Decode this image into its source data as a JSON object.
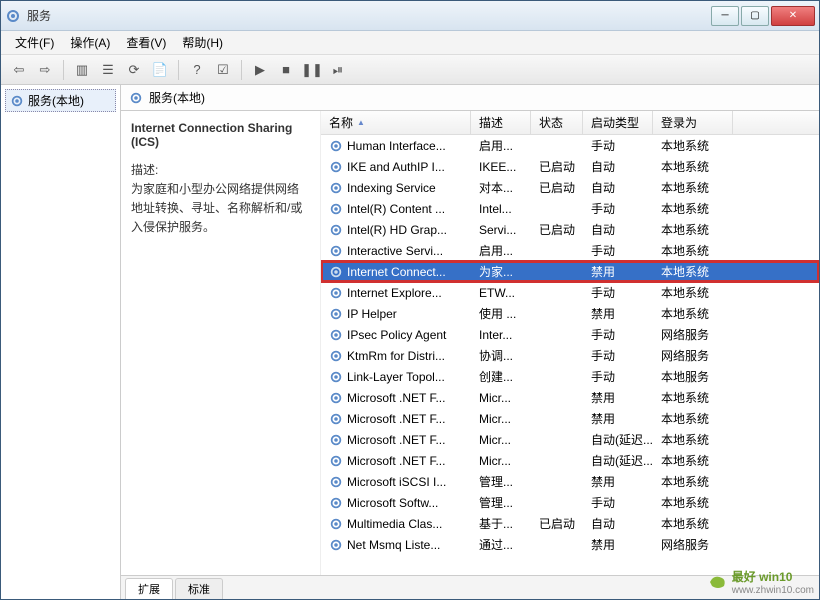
{
  "window": {
    "title": "服务"
  },
  "menu": {
    "file": "文件(F)",
    "action": "操作(A)",
    "view": "查看(V)",
    "help": "帮助(H)"
  },
  "left": {
    "node": "服务(本地)"
  },
  "panel": {
    "heading": "服务(本地)",
    "selected_name": "Internet Connection Sharing (ICS)",
    "desc_label": "描述:",
    "desc_text": "为家庭和小型办公网络提供网络地址转换、寻址、名称解析和/或入侵保护服务。"
  },
  "columns": {
    "name": "名称",
    "desc": "描述",
    "status": "状态",
    "start": "启动类型",
    "logon": "登录为"
  },
  "rows": [
    {
      "name": "Human Interface...",
      "desc": "启用...",
      "status": "",
      "start": "手动",
      "logon": "本地系统"
    },
    {
      "name": "IKE and AuthIP I...",
      "desc": "IKEE...",
      "status": "已启动",
      "start": "自动",
      "logon": "本地系统"
    },
    {
      "name": "Indexing Service",
      "desc": "对本...",
      "status": "已启动",
      "start": "自动",
      "logon": "本地系统"
    },
    {
      "name": "Intel(R) Content ...",
      "desc": "Intel...",
      "status": "",
      "start": "手动",
      "logon": "本地系统"
    },
    {
      "name": "Intel(R) HD Grap...",
      "desc": "Servi...",
      "status": "已启动",
      "start": "自动",
      "logon": "本地系统"
    },
    {
      "name": "Interactive Servi...",
      "desc": "启用...",
      "status": "",
      "start": "手动",
      "logon": "本地系统"
    },
    {
      "name": "Internet Connect...",
      "desc": "为家...",
      "status": "",
      "start": "禁用",
      "logon": "本地系统",
      "selected": true,
      "highlighted": true
    },
    {
      "name": "Internet Explore...",
      "desc": "ETW...",
      "status": "",
      "start": "手动",
      "logon": "本地系统"
    },
    {
      "name": "IP Helper",
      "desc": "使用 ...",
      "status": "",
      "start": "禁用",
      "logon": "本地系统"
    },
    {
      "name": "IPsec Policy Agent",
      "desc": "Inter...",
      "status": "",
      "start": "手动",
      "logon": "网络服务"
    },
    {
      "name": "KtmRm for Distri...",
      "desc": "协调...",
      "status": "",
      "start": "手动",
      "logon": "网络服务"
    },
    {
      "name": "Link-Layer Topol...",
      "desc": "创建...",
      "status": "",
      "start": "手动",
      "logon": "本地服务"
    },
    {
      "name": "Microsoft .NET F...",
      "desc": "Micr...",
      "status": "",
      "start": "禁用",
      "logon": "本地系统"
    },
    {
      "name": "Microsoft .NET F...",
      "desc": "Micr...",
      "status": "",
      "start": "禁用",
      "logon": "本地系统"
    },
    {
      "name": "Microsoft .NET F...",
      "desc": "Micr...",
      "status": "",
      "start": "自动(延迟...",
      "logon": "本地系统"
    },
    {
      "name": "Microsoft .NET F...",
      "desc": "Micr...",
      "status": "",
      "start": "自动(延迟...",
      "logon": "本地系统"
    },
    {
      "name": "Microsoft iSCSI I...",
      "desc": "管理...",
      "status": "",
      "start": "禁用",
      "logon": "本地系统"
    },
    {
      "name": "Microsoft Softw...",
      "desc": "管理...",
      "status": "",
      "start": "手动",
      "logon": "本地系统"
    },
    {
      "name": "Multimedia Clas...",
      "desc": "基于...",
      "status": "已启动",
      "start": "自动",
      "logon": "本地系统"
    },
    {
      "name": "Net Msmq Liste...",
      "desc": "通过...",
      "status": "",
      "start": "禁用",
      "logon": "网络服务"
    }
  ],
  "tabs": {
    "extended": "扩展",
    "standard": "标准"
  },
  "watermark": {
    "brand": "最好 win10",
    "url": "www.zhwin10.com"
  }
}
